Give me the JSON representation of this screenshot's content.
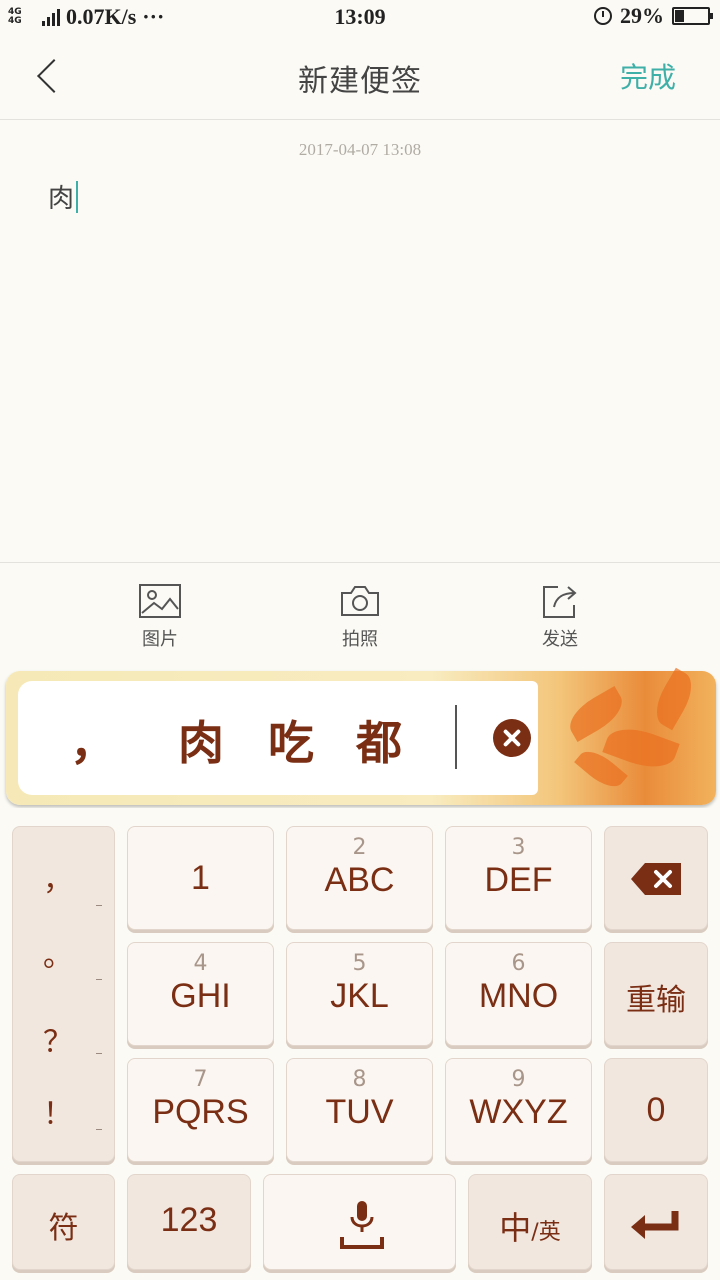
{
  "status_bar": {
    "network": "4G 4G",
    "speed": "0.07K/s",
    "dots": "···",
    "time": "13:09",
    "battery": "29%"
  },
  "header": {
    "title": "新建便签",
    "done_label": "完成"
  },
  "note": {
    "timestamp": "2017-04-07 13:08",
    "content": "肉"
  },
  "toolbar": {
    "picture_label": "图片",
    "camera_label": "拍照",
    "send_label": "发送"
  },
  "candidates": {
    "items": [
      "，",
      "肉",
      "吃",
      "都"
    ]
  },
  "keyboard": {
    "punctuation": [
      "，",
      "。",
      "？",
      "！"
    ],
    "keys": {
      "k1": {
        "digit": "",
        "letters": "1"
      },
      "k2": {
        "digit": "2",
        "letters": "ABC"
      },
      "k3": {
        "digit": "3",
        "letters": "DEF"
      },
      "k4": {
        "digit": "4",
        "letters": "GHI"
      },
      "k5": {
        "digit": "5",
        "letters": "JKL"
      },
      "k6": {
        "digit": "6",
        "letters": "MNO"
      },
      "k7": {
        "digit": "7",
        "letters": "PQRS"
      },
      "k8": {
        "digit": "8",
        "letters": "TUV"
      },
      "k9": {
        "digit": "9",
        "letters": "WXYZ"
      }
    },
    "retype_label": "重输",
    "zero_label": "0",
    "symbol_label": "符",
    "num_label": "123",
    "lang_main": "中",
    "lang_sub": "/英"
  }
}
